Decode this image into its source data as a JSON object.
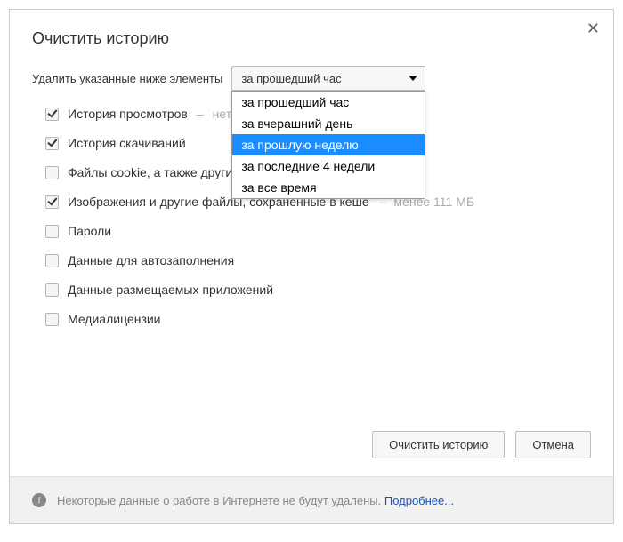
{
  "title": "Очистить историю",
  "close_glyph": "✕",
  "time_label": "Удалить указанные ниже элементы",
  "select": {
    "value": "за прошедший час",
    "options": [
      "за прошедший час",
      "за вчерашний день",
      "за прошлую неделю",
      "за последние 4 недели",
      "за все время"
    ],
    "highlighted_index": 2
  },
  "items": [
    {
      "label": "История просмотров",
      "checked": true,
      "hint": "нет"
    },
    {
      "label": "История скачиваний",
      "checked": true,
      "hint": ""
    },
    {
      "label": "Файлы cookie, а также другие данные сайтов и плагинов",
      "checked": false,
      "hint": ""
    },
    {
      "label": "Изображения и другие файлы, сохраненные в кеше",
      "checked": true,
      "hint": "менее 111 МБ"
    },
    {
      "label": "Пароли",
      "checked": false,
      "hint": ""
    },
    {
      "label": "Данные для автозаполнения",
      "checked": false,
      "hint": ""
    },
    {
      "label": "Данные размещаемых приложений",
      "checked": false,
      "hint": ""
    },
    {
      "label": "Медиалицензии",
      "checked": false,
      "hint": ""
    }
  ],
  "buttons": {
    "clear": "Очистить историю",
    "cancel": "Отмена"
  },
  "footer": {
    "info_glyph": "i",
    "text": "Некоторые данные о работе в Интернете не будут удалены. ",
    "link": "Подробнее..."
  },
  "hint_separator": "–"
}
